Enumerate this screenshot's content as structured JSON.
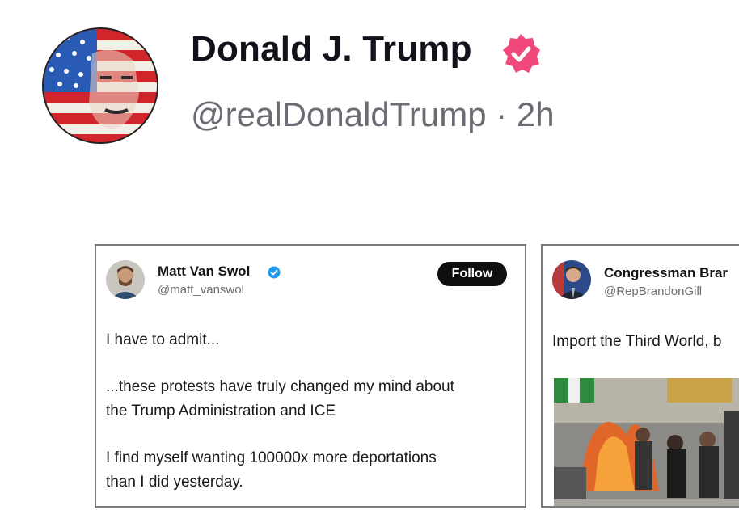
{
  "post": {
    "author_name": "Donald J. Trump",
    "handle": "@realDonaldTrump",
    "separator": "·",
    "time_ago": "2h",
    "verified_color": "#f0487a"
  },
  "embedded_cards": [
    {
      "author_name": "Matt Van Swol",
      "handle": "@matt_vanswol",
      "follow_label": "Follow",
      "verified_color": "#1d9bf0",
      "lines": [
        "I have to admit...",
        "...these protests have truly changed my mind about",
        "the Trump Administration and ICE",
        "I find myself wanting 100000x more deportations",
        "than I did yesterday."
      ]
    },
    {
      "author_name": "Congressman Brar",
      "handle": "@RepBrandonGill",
      "lines": [
        "Import the Third World, b"
      ]
    }
  ]
}
